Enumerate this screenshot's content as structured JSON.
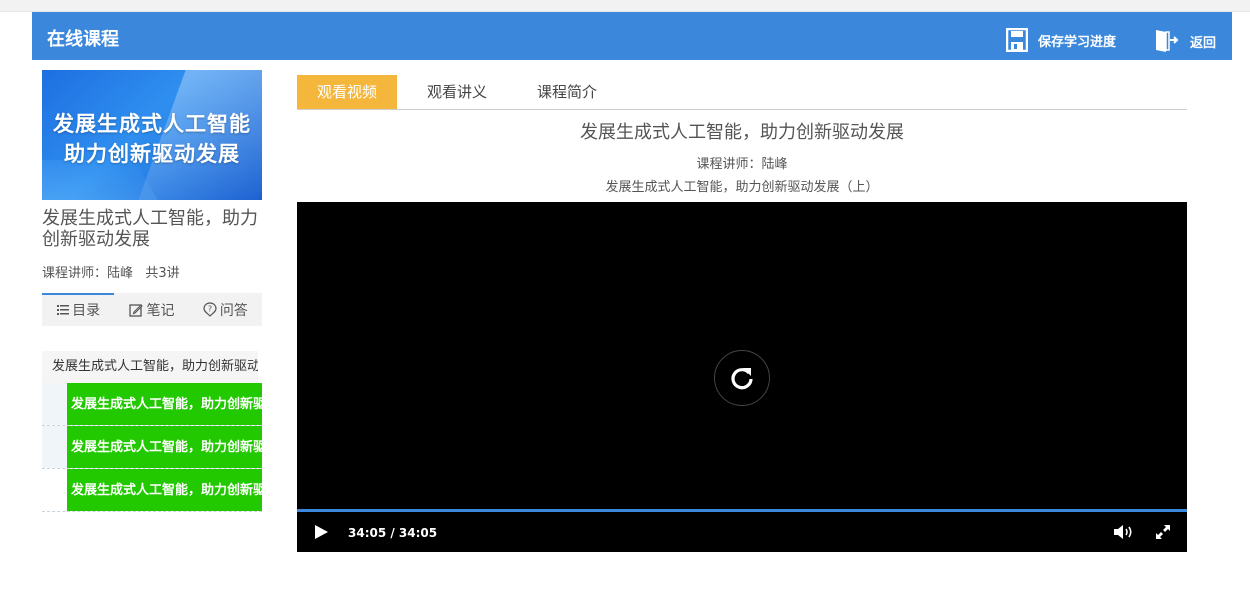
{
  "header": {
    "title": "在线课程",
    "save_label": "保存学习进度",
    "back_label": "返回"
  },
  "sidebar": {
    "banner_line1": "发展生成式人工智能",
    "banner_line2": "助力创新驱动发展",
    "course_title": "发展生成式人工智能，助力创新驱动发展",
    "meta": "课程讲师：陆峰   共3讲",
    "tabs": [
      {
        "label": "目录",
        "icon": "list-icon"
      },
      {
        "label": "笔记",
        "icon": "edit-icon"
      },
      {
        "label": "问答",
        "icon": "question-icon"
      }
    ],
    "chapter": "发展生成式人工智能，助力创新驱动发展",
    "lessons": [
      "发展生成式人工智能，助力创新驱动发展（上）",
      "发展生成式人工智能，助力创新驱动发展（中）",
      "发展生成式人工智能，助力创新驱动发展（下）"
    ]
  },
  "main": {
    "tabs": [
      "观看视频",
      "观看讲义",
      "课程简介"
    ],
    "active_tab": "观看视频",
    "video_title": "发展生成式人工智能，助力创新驱动发展",
    "lecturer": "课程讲师：陆峰",
    "episode": "发展生成式人工智能，助力创新驱动发展（上）"
  },
  "player": {
    "time": "34:05 / 34:05",
    "progress": 1.0,
    "accent": "#3a87dc"
  },
  "colors": {
    "header_bg": "#3a87dc",
    "active_tab_bg": "#f5b73b",
    "lesson_bg": "#22c900"
  }
}
